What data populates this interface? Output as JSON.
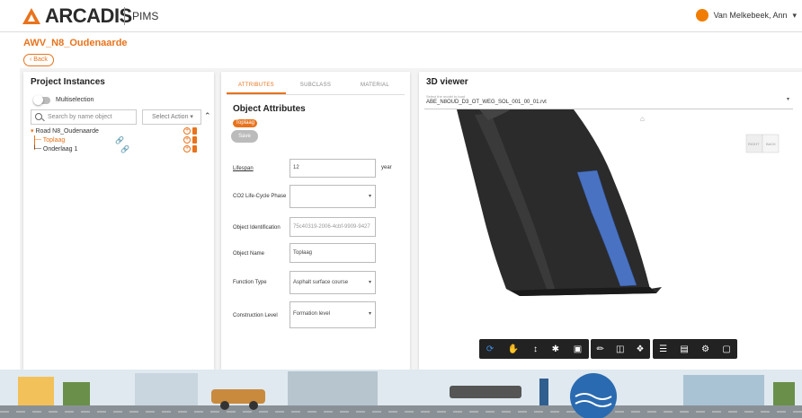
{
  "header": {
    "brand": "ARCADIS",
    "app_name": "PIMS",
    "user_name": "Van Melkebeek, Ann",
    "brand_color": "#e8731c"
  },
  "page": {
    "title": "AWV_N8_Oudenaarde",
    "back_label": "Back"
  },
  "project_instances": {
    "title": "Project Instances",
    "multiselection_label": "Multiselection",
    "search_placeholder": "Search by name object",
    "select_action_label": "Select Action",
    "tree": [
      {
        "label": "Road N8_Oudenaarde"
      },
      {
        "label": "Toplaag"
      },
      {
        "label": "Onderlaag 1"
      }
    ]
  },
  "attributes_panel": {
    "tabs": [
      {
        "label": "ATTRIBUTES"
      },
      {
        "label": "SUBCLASS"
      },
      {
        "label": "MATERIAL"
      }
    ],
    "title": "Object Attributes",
    "badge": "Toplaag",
    "save_label": "Save",
    "fields": [
      {
        "label": "Lifespan",
        "value": "12",
        "unit": "year"
      },
      {
        "label": "CO2 Life-Cycle Phase",
        "value": ""
      },
      {
        "label": "Object Identification",
        "value": "75c40319-2006-4cbf-9909-9427"
      },
      {
        "label": "Object Name",
        "value": "Toplaag"
      },
      {
        "label": "Function Type",
        "value": "Asphalt surface course"
      },
      {
        "label": "Construction Level",
        "value": "Formation level"
      }
    ]
  },
  "viewer": {
    "title": "3D viewer",
    "select_hint": "Select the model to load",
    "model_value": "ABE_N8OUD_D3_OT_WEG_SOL_001_00_01.rvt",
    "cube_labels": [
      "RIGHT",
      "BACK"
    ],
    "toolbar_icons": [
      "orbit-icon",
      "pan-icon",
      "zoom-icon",
      "walk-icon",
      "camera-icon",
      "measure-icon",
      "section-icon",
      "explode-icon",
      "model-browser-icon",
      "properties-icon",
      "settings-icon",
      "fullscreen-icon"
    ],
    "highlight_color": "#4a72c2"
  }
}
